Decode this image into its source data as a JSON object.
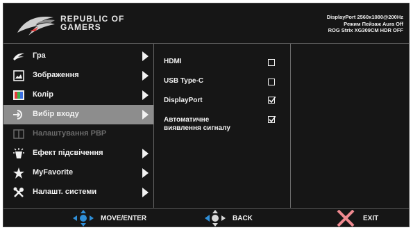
{
  "header": {
    "brand_line1": "REPUBLIC OF",
    "brand_line2": "GAMERS",
    "status_line1": "DisplayPort 2560x1080@200Hz",
    "status_line2": "Режим Пейзаж Aura Off",
    "status_line3": "ROG Strix XG309CM HDR OFF"
  },
  "menu": {
    "items": [
      {
        "label": "Гра",
        "icon": "rog-eye-icon",
        "arrow": true
      },
      {
        "label": "Зображення",
        "icon": "image-icon",
        "arrow": true
      },
      {
        "label": "Колір",
        "icon": "color-icon",
        "arrow": true
      },
      {
        "label": "Вибір входу",
        "icon": "input-icon",
        "arrow": true,
        "selected": true
      },
      {
        "label": "Налаштування PBP",
        "icon": "pbp-icon",
        "arrow": false,
        "disabled": true
      },
      {
        "label": "Ефект підсвічення",
        "icon": "lighting-icon",
        "arrow": true
      },
      {
        "label": "MyFavorite",
        "icon": "star-icon",
        "arrow": true
      },
      {
        "label": "Налашт. системи",
        "icon": "wrench-icon",
        "arrow": true
      }
    ]
  },
  "submenu": {
    "items": [
      {
        "label": "HDMI",
        "checked": false
      },
      {
        "label": "USB Type-C",
        "checked": false
      },
      {
        "label": "DisplayPort",
        "checked": true
      },
      {
        "label_line1": "Автоматичне",
        "label_line2": "виявлення сигналу",
        "checked": true
      }
    ]
  },
  "footer": {
    "move_label": "MOVE/ENTER",
    "back_label": "BACK",
    "exit_label": "EXIT"
  },
  "colors": {
    "background": "#161616",
    "selected": "#8d8d8d",
    "text": "#f2f2f2",
    "disabled": "#6b6b6b",
    "nav_blue": "#2f8fd8",
    "exit_pink": "#f08a90"
  }
}
